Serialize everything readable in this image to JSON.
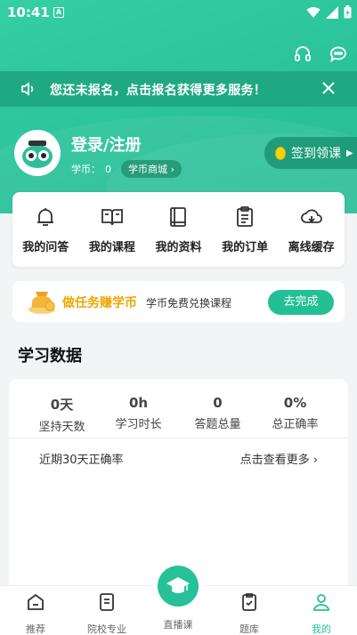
{
  "status": {
    "time": "10:41",
    "a_glyph": "A"
  },
  "notice": {
    "text": "您还未报名，点击报名获得更多服务！"
  },
  "profile": {
    "login_label": "登录/注册",
    "coin_label": "学币：",
    "coin_value": "0",
    "mall_label": "学币商城",
    "checkin_label": "签到领课"
  },
  "features": [
    {
      "label": "我的问答",
      "icon": "bell-icon"
    },
    {
      "label": "我的课程",
      "icon": "book-open-icon"
    },
    {
      "label": "我的资料",
      "icon": "book-icon"
    },
    {
      "label": "我的订单",
      "icon": "clipboard-icon"
    },
    {
      "label": "离线缓存",
      "icon": "cloud-download-icon"
    }
  ],
  "task": {
    "title": "做任务赚学币",
    "subtitle": "学币免费兑换课程",
    "button": "去完成"
  },
  "study": {
    "title": "学习数据",
    "stats": [
      {
        "value": "0天",
        "label": "坚持天数"
      },
      {
        "value": "0h",
        "label": "学习时长"
      },
      {
        "value": "0",
        "label": "答题总量"
      },
      {
        "value": "0%",
        "label": "总正确率"
      }
    ],
    "recent_label": "近期30天正确率",
    "more_label": "点击查看更多"
  },
  "nav": {
    "items": [
      {
        "label": "推荐",
        "icon": "home-icon"
      },
      {
        "label": "院校专业",
        "icon": "document-icon"
      },
      {
        "label": "直播课",
        "icon": "graduation-cap-icon"
      },
      {
        "label": "题库",
        "icon": "checklist-icon"
      },
      {
        "label": "我的",
        "icon": "user-icon"
      }
    ],
    "active": "我的"
  },
  "colors": {
    "brand_green": "#26c197",
    "notice_bg": "#1fa982",
    "task_orange": "#f0a500",
    "coin_yellow": "#f5d300"
  }
}
